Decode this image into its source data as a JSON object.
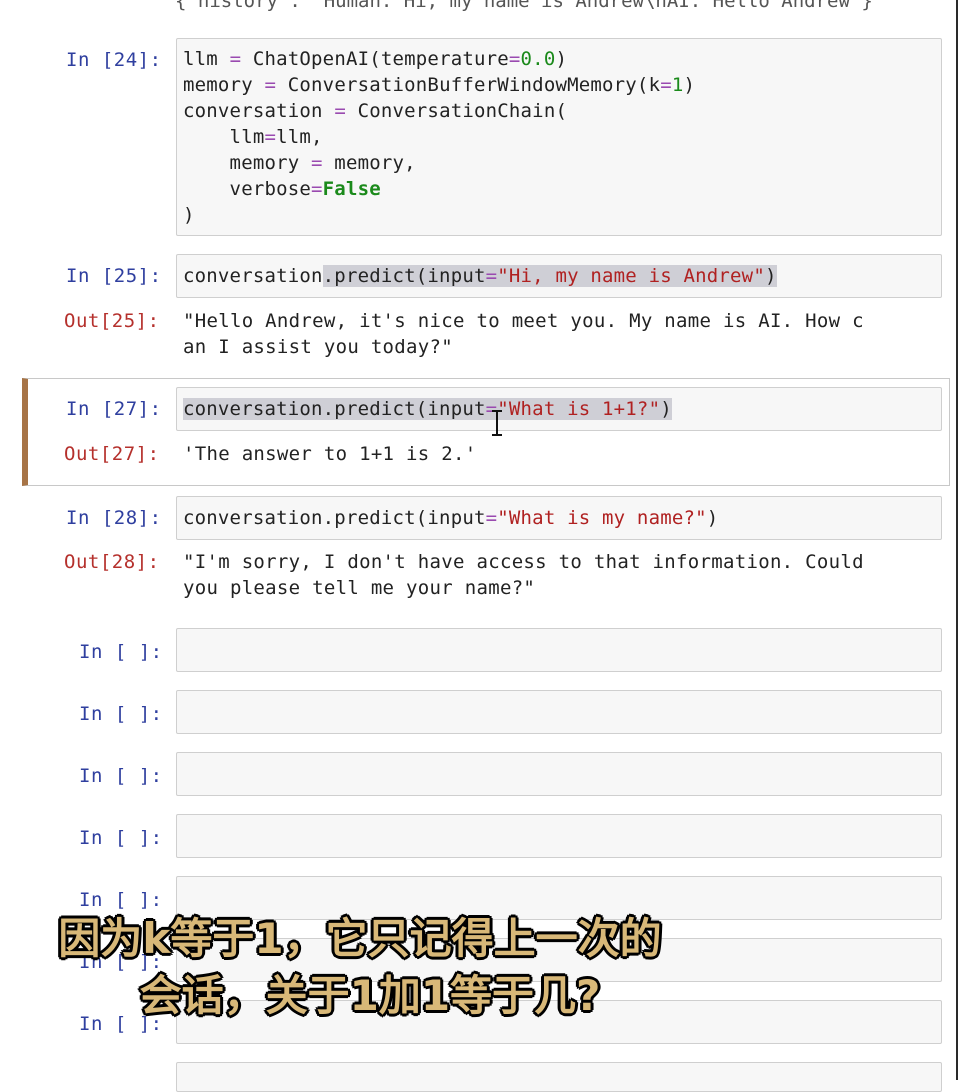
{
  "top_partial_text": "{'history': 'Human: Hi, my name is Andrew\\nAI: Hello Andrew'}",
  "cells": [
    {
      "prompt": "In [24]:",
      "code_lines": [
        "llm = ChatOpenAI(temperature=0.0)",
        "memory = ConversationBufferWindowMemory(k=1)",
        "conversation = ConversationChain(",
        "    llm=llm,",
        "    memory = memory,",
        "    verbose=False",
        ")"
      ]
    },
    {
      "prompt": "In [25]:",
      "code": "conversation.predict(input=\"Hi, my name is Andrew\")",
      "out_prompt": "Out[25]:",
      "output_lines": [
        "\"Hello Andrew, it's nice to meet you. My name is AI. How c",
        "an I assist you today?\""
      ]
    },
    {
      "prompt": "In [27]:",
      "code": "conversation.predict(input=\"What is 1+1?\")",
      "out_prompt": "Out[27]:",
      "output_lines": [
        "'The answer to 1+1 is 2.'"
      ]
    },
    {
      "prompt": "In [28]:",
      "code": "conversation.predict(input=\"What is my name?\")",
      "out_prompt": "Out[28]:",
      "output_lines": [
        "\"I'm sorry, I don't have access to that information. Could",
        "you please tell me your name?\""
      ]
    }
  ],
  "empty_prompt": "In [ ]:",
  "subtitle": {
    "line1": "因为k等于1，它只记得上一次的",
    "line2": "会话，关于1加1等于几?"
  },
  "colors": {
    "in_prompt": "#2f3f9f",
    "out_prompt": "#b5302c",
    "selected_bar": "#a77446",
    "subtitle": "#d8b878"
  }
}
